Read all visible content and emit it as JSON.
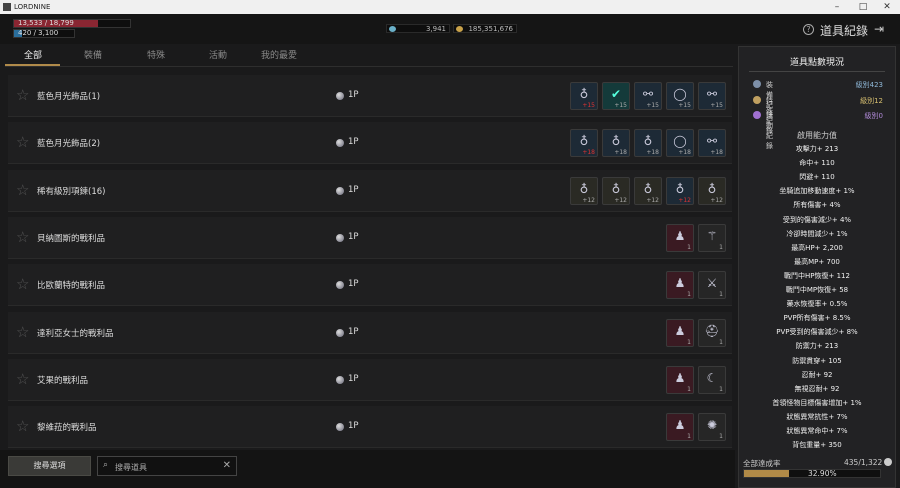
{
  "window": {
    "title": "LORDNINE"
  },
  "hud": {
    "hp_text": "13,533 / 18,799",
    "hp_fraction": 0.72,
    "mp_text": "420 / 3,100",
    "mp_fraction": 0.14,
    "currency": [
      {
        "icon": "eye-currency-icon",
        "value": "3,941",
        "color": "#6ab0c8"
      },
      {
        "icon": "gold-coin-icon",
        "value": "185,351,676",
        "color": "#c9a24a"
      }
    ],
    "page_title": "道具紀錄"
  },
  "tabs": [
    "全部",
    "裝備",
    "特殊",
    "活動",
    "我的最愛"
  ],
  "active_tab": 0,
  "rows": [
    {
      "name": "藍色月光飾品(1)",
      "points": "1P",
      "slots": [
        {
          "glyph": "♁",
          "badge": "+15",
          "badge_red": true,
          "tint": "#1d2a36"
        },
        {
          "glyph": "✔",
          "badge": "+15",
          "badge_red": false,
          "tint": "#143a3a",
          "checked": true
        },
        {
          "glyph": "⚯",
          "badge": "+15",
          "badge_red": false,
          "tint": "#1d2a36"
        },
        {
          "glyph": "◯",
          "badge": "+15",
          "badge_red": false,
          "tint": "#1d2a36"
        },
        {
          "glyph": "⚯",
          "badge": "+15",
          "badge_red": false,
          "tint": "#1d2a36"
        }
      ]
    },
    {
      "name": "藍色月光飾品(2)",
      "points": "1P",
      "slots": [
        {
          "glyph": "♁",
          "badge": "+18",
          "badge_red": true,
          "tint": "#1d2a36"
        },
        {
          "glyph": "♁",
          "badge": "+18",
          "badge_red": false,
          "tint": "#1d2a36"
        },
        {
          "glyph": "♁",
          "badge": "+18",
          "badge_red": false,
          "tint": "#1d2a36"
        },
        {
          "glyph": "◯",
          "badge": "+18",
          "badge_red": false,
          "tint": "#1d2a36"
        },
        {
          "glyph": "⚯",
          "badge": "+18",
          "badge_red": false,
          "tint": "#1d2a36"
        }
      ]
    },
    {
      "name": "稀有級別項鍊(16)",
      "points": "1P",
      "slots": [
        {
          "glyph": "♁",
          "badge": "+12",
          "badge_red": false,
          "tint": "#2a2a24"
        },
        {
          "glyph": "♁",
          "badge": "+12",
          "badge_red": false,
          "tint": "#2a2a24"
        },
        {
          "glyph": "♁",
          "badge": "+12",
          "badge_red": false,
          "tint": "#2a2a24"
        },
        {
          "glyph": "♁",
          "badge": "+12",
          "badge_red": true,
          "tint": "#1d2a36"
        },
        {
          "glyph": "♁",
          "badge": "+12",
          "badge_red": false,
          "tint": "#2a2a24"
        }
      ]
    },
    {
      "name": "貝納圖斯的戰利品",
      "points": "1P",
      "slots": [
        {
          "glyph": "♟",
          "badge": "1",
          "badge_red": false,
          "tint": "#3a1a22"
        },
        {
          "glyph": "⚚",
          "badge": "1",
          "badge_red": false,
          "tint": "#262626"
        }
      ]
    },
    {
      "name": "比歐蘭特的戰利品",
      "points": "1P",
      "slots": [
        {
          "glyph": "♟",
          "badge": "1",
          "badge_red": false,
          "tint": "#3a1a22"
        },
        {
          "glyph": "⚔",
          "badge": "1",
          "badge_red": false,
          "tint": "#262626"
        }
      ]
    },
    {
      "name": "達利亞女士的戰利品",
      "points": "1P",
      "slots": [
        {
          "glyph": "♟",
          "badge": "1",
          "badge_red": false,
          "tint": "#3a1a22"
        },
        {
          "glyph": "⛑",
          "badge": "1",
          "badge_red": false,
          "tint": "#262626"
        }
      ]
    },
    {
      "name": "艾果的戰利品",
      "points": "1P",
      "slots": [
        {
          "glyph": "♟",
          "badge": "1",
          "badge_red": false,
          "tint": "#3a1a22"
        },
        {
          "glyph": "☾",
          "badge": "1",
          "badge_red": false,
          "tint": "#262626"
        }
      ]
    },
    {
      "name": "黎維菈的戰利品",
      "points": "1P",
      "slots": [
        {
          "glyph": "♟",
          "badge": "1",
          "badge_red": false,
          "tint": "#3a1a22"
        },
        {
          "glyph": "✺",
          "badge": "1",
          "badge_red": false,
          "tint": "#262626"
        }
      ]
    }
  ],
  "bottom": {
    "search_button": "搜尋選項",
    "search_placeholder": "搜尋道具"
  },
  "panel": {
    "title": "道具點數現況",
    "records": [
      {
        "label": "裝備紀錄",
        "value": "級別423",
        "color": "#8fb8d8",
        "icon_color": "#7d8fa8"
      },
      {
        "label": "特殊紀錄",
        "value": "級別12",
        "color": "#d8c070",
        "icon_color": "#c0a060"
      },
      {
        "label": "活動紀錄",
        "value": "級別0",
        "color": "#b08ad8",
        "icon_color": "#a070d0"
      }
    ],
    "effects_title": "啟用能力值",
    "effects": [
      "攻擊力+ 213",
      "命中+ 110",
      "閃避+ 110",
      "坐騎追加移動速度+ 1%",
      "所有傷害+ 4%",
      "受到的傷害減少+ 4%",
      "冷卻時間減少+ 1%",
      "最高HP+ 2,200",
      "最高MP+ 700",
      "戰鬥中HP恢復+ 112",
      "戰鬥中MP恢復+ 58",
      "藥水恢復率+ 0.5%",
      "PVP所有傷害+ 8.5%",
      "PVP受到的傷害減少+ 8%",
      "防禦力+ 213",
      "防禦貫穿+ 105",
      "忍耐+ 92",
      "無視忍耐+ 92",
      "首領怪物目標傷害增加+ 1%",
      "狀態異常抗性+ 7%",
      "狀態異常命中+ 7%",
      "背包重量+ 350"
    ],
    "rate_label": "全部達成率",
    "rate_count": "435/1,322",
    "rate_percent": "32.90%",
    "rate_fraction": 0.329
  }
}
